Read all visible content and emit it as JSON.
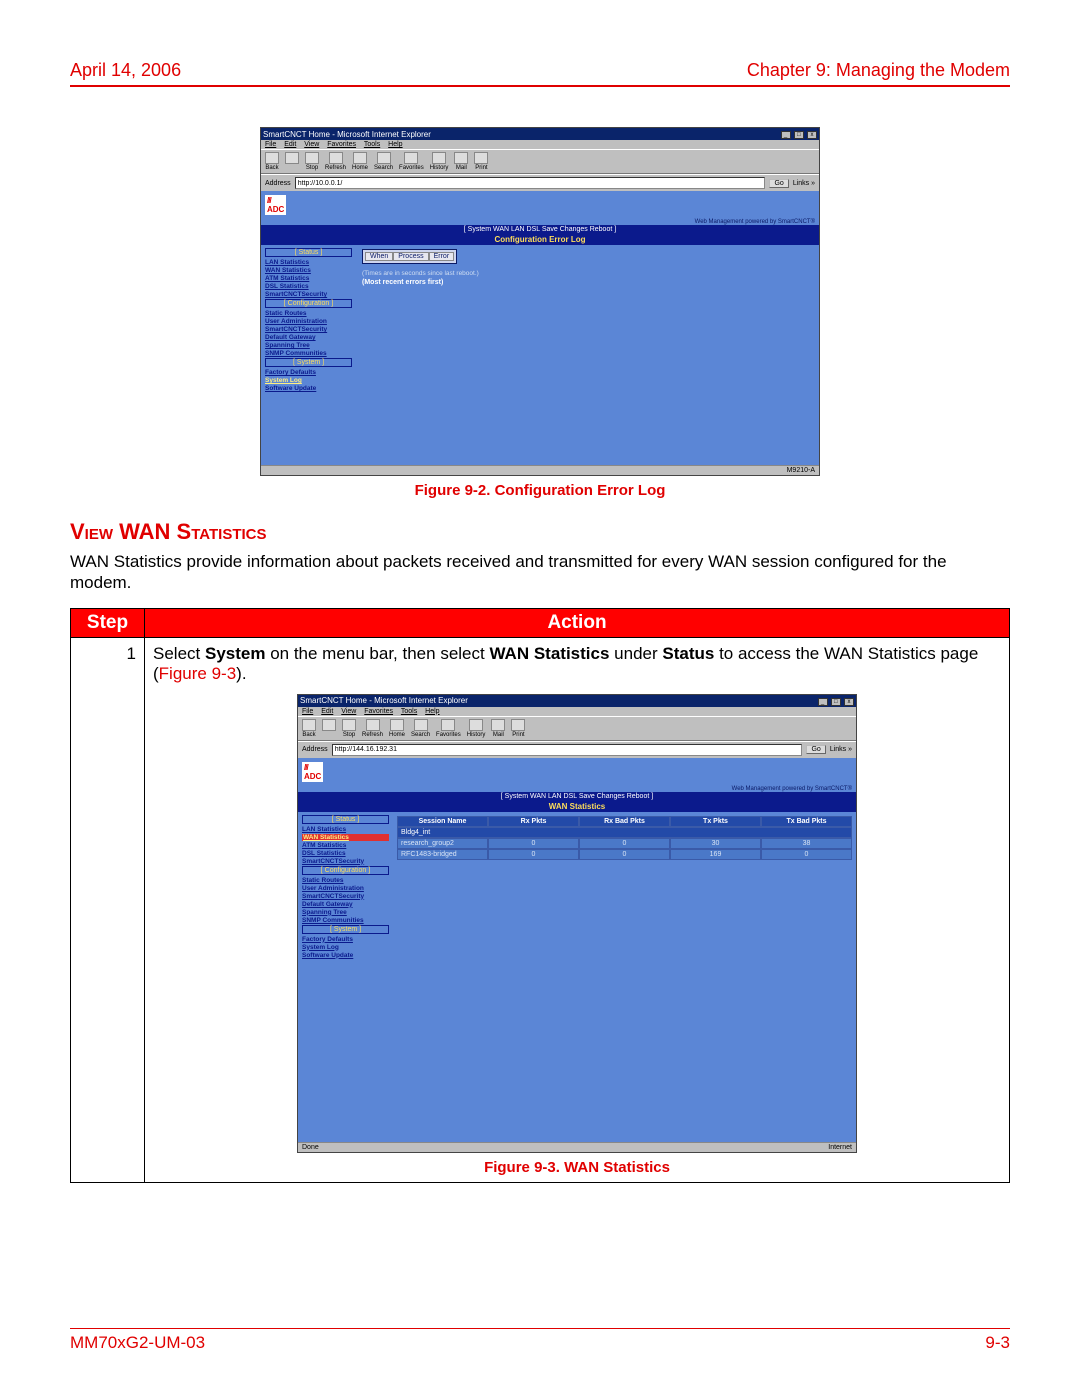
{
  "header": {
    "date": "April 14, 2006",
    "chapter": "Chapter 9: Managing the Modem"
  },
  "fig1": {
    "caption": "Figure 9-2. Configuration Error Log",
    "ie_title": "SmartCNCT Home - Microsoft Internet Explorer",
    "menu": [
      "File",
      "Edit",
      "View",
      "Favorites",
      "Tools",
      "Help"
    ],
    "toolbar": [
      "Back",
      "",
      "Stop",
      "Refresh",
      "Home",
      "Search",
      "Favorites",
      "History",
      "Mail",
      "Print"
    ],
    "addr_label": "Address",
    "addr_value": "http://10.0.0.1/",
    "go": "Go",
    "links": "Links »",
    "adc_sub": "Web Management powered by SmartCNCT®",
    "topbar": "[ System  WAN  LAN  DSL  Save Changes  Reboot ]",
    "content_title": "Configuration Error Log",
    "side_groups": {
      "status": "[ Status ]",
      "config": "[ Configuration ]",
      "system": "[ System ]"
    },
    "side_status": [
      "LAN Statistics",
      "WAN Statistics",
      "ATM Statistics",
      "DSL Statistics",
      "SmartCNCTSecurity"
    ],
    "side_config": [
      "Static Routes",
      "User Administration",
      "SmartCNCTSecurity",
      "Default Gateway",
      "Spanning Tree",
      "SNMP Communities"
    ],
    "side_system": [
      "Factory Defaults",
      "System Log",
      "Software Update"
    ],
    "cfg_cols": [
      "When",
      "Process",
      "Error"
    ],
    "note1": "(Times are in seconds since last reboot.)",
    "note2": "(Most recent errors first)",
    "statusbar_right": "M9210-A"
  },
  "section": {
    "title": "View WAN Statistics",
    "para": "WAN Statistics provide information about packets received and transmitted for every WAN session configured for the modem."
  },
  "table": {
    "head_step": "Step",
    "head_action": "Action",
    "step_num": "1",
    "action_pre": "Select ",
    "b1": "System",
    "mid1": " on the menu bar, then select ",
    "b2": "WAN Statistics",
    "mid2": " under ",
    "b3": "Status",
    "mid3": " to access the WAN Statistics page (",
    "linkref": "Figure 9-3",
    "post": ")."
  },
  "fig2": {
    "caption": "Figure 9-3. WAN Statistics",
    "addr_value": "http://144.16.192.31",
    "content_title": "WAN Statistics",
    "wan_heads": [
      "Session Name",
      "Rx Pkts",
      "Rx Bad Pkts",
      "Tx Pkts",
      "Tx Bad Pkts"
    ],
    "wan_sub": "Bldg4_int",
    "rows": [
      [
        "research_group2",
        "0",
        "0",
        "30",
        "38"
      ],
      [
        "RFC1483-bridged",
        "0",
        "0",
        "169",
        "0"
      ]
    ],
    "status_left": "Done",
    "status_right": "Internet"
  },
  "footer": {
    "left": "MM70xG2-UM-03",
    "right": "9-3"
  },
  "chart_data": {
    "type": "table",
    "title": "WAN Statistics",
    "columns": [
      "Session Name",
      "Rx Pkts",
      "Rx Bad Pkts",
      "Tx Pkts",
      "Tx Bad Pkts"
    ],
    "rows": [
      {
        "Session Name": "research_group2",
        "Rx Pkts": 0,
        "Rx Bad Pkts": 0,
        "Tx Pkts": 30,
        "Tx Bad Pkts": 38
      },
      {
        "Session Name": "RFC1483-bridged",
        "Rx Pkts": 0,
        "Rx Bad Pkts": 0,
        "Tx Pkts": 169,
        "Tx Bad Pkts": 0
      }
    ]
  }
}
